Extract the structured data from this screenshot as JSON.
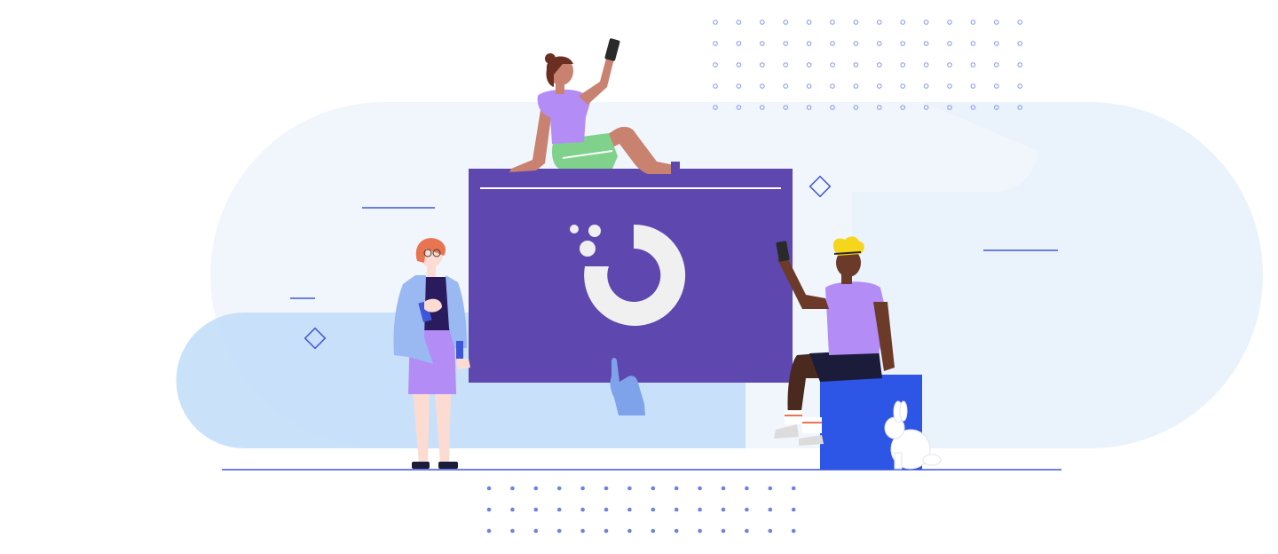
{
  "illustration": {
    "colors": {
      "background": "#ffffff",
      "pale_band": "#f1f6fc",
      "pale_band_right": "#eaf2fb",
      "blue_pill": "#c4def9",
      "board": "#5f47b0",
      "logo": "#f0f0f0",
      "accent_line": "#3f56d8",
      "dot_outline": "#8598ea",
      "dot_fill": "#6f82e3",
      "cube": "#2d55e6",
      "lavender": "#b48cf6",
      "skin_light": "#fcdcd2",
      "skin_tan": "#c8826f",
      "skin_dark": "#6b3a28",
      "hair_orange": "#e8754f",
      "hair_yellow": "#f6d51d",
      "jacket": "#9ab8f2",
      "shorts_green": "#7fd18c",
      "hand_blue": "#7fa3ea",
      "rabbit": "#ffffff"
    },
    "icons": [
      "brand-logo-icon",
      "pointing-hand-icon",
      "diamond-icon",
      "rabbit-icon",
      "smartphone-icon"
    ]
  }
}
